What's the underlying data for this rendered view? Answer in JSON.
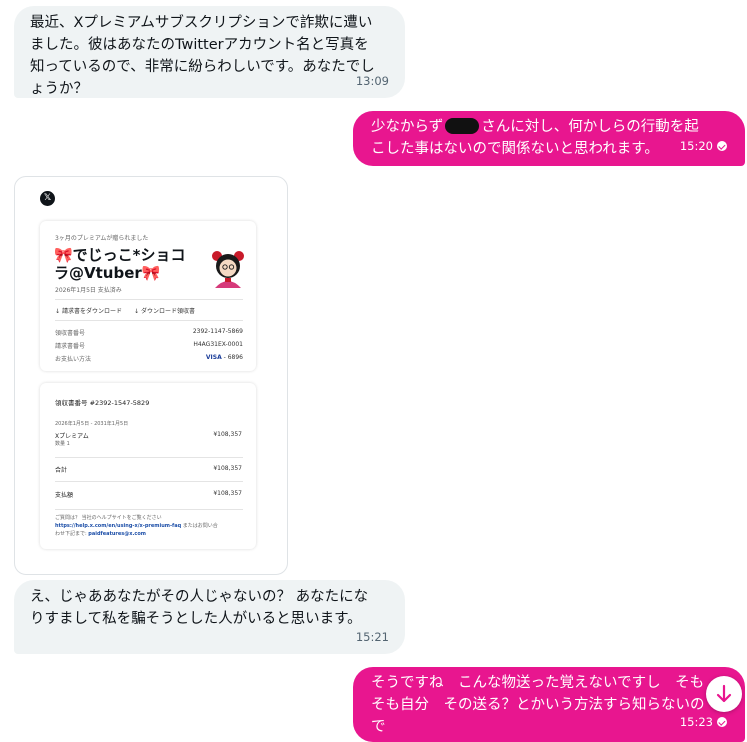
{
  "messages": [
    {
      "text": "最近、Xプレミアムサブスクリプションで詐欺に遭いました。彼はあなたのTwitterアカウント名と写真を知っているので、非常に紛らわしいです。あなたでしょうか？",
      "lines": [
        "最近、Xプレミアムサブスクリプションで詐欺に遭い",
        "ました。彼はあなたのTwitterアカウント名と写真を",
        "知っているので、非常に紛らわしいです。あなたでし",
        "ょうか？"
      ],
      "time": "13:09"
    },
    {
      "line1_pre": "少なからず",
      "line1_post": "さんに対し、何かしらの行動を起",
      "line2": "こした事はないので関係ないと思われます。",
      "time": "15:20"
    },
    {
      "lines": [
        "え、じゃああなたがその人じゃないの？ あなたにな",
        "りすまして私を騙そうとした人がいると思います。"
      ],
      "time": "15:21"
    },
    {
      "lines": [
        "そうですね　こんな物送った覚えないですし　そも",
        "そも自分　その送る？とかいう方法すら知らないの",
        "で"
      ],
      "time": "15:23"
    }
  ],
  "receipt": {
    "logo": "𝕏",
    "gift_note": "3ヶ月のプレミアムが贈られました",
    "name_line1": "🎀でじっこ*ショコ",
    "name_line2": "ラ@Vtuber🎀",
    "paid_date": "2026年1月5日 支払済み",
    "download_invoice": "請求書をダウンロード",
    "download_receipt": "ダウンロード領収書",
    "rows": [
      {
        "label": "領収書番号",
        "value": "2392-1147-5869"
      },
      {
        "label": "請求書番号",
        "value": "H4AG31EX-0001"
      },
      {
        "label": "お支払い方法",
        "value_brand": "VISA",
        "value": " - 6896"
      }
    ],
    "detail_title": "領収書番号 #2392-1547-5829",
    "period": "2026年1月5日 - 2031年1月5日",
    "item_name": "Xプレミアム",
    "item_qty": "数量 1",
    "item_price": "¥108,357",
    "total_label": "合計",
    "total_value": "¥108,357",
    "paid_label": "支払額",
    "paid_value": "¥108,357",
    "help_line1": "ご質問は？ 当社のヘルプサイトをご覧ください",
    "help_link": "https://help.x.com/en/using-x/x-premium-faq",
    "help_line2_suffix": " またはお問い合",
    "help_line3_prefix": "わせ下記まで: ",
    "help_email": "paidfeatures@x.com"
  },
  "icons": {
    "scroll_down": "arrow-down-icon",
    "read": "check-circle-icon"
  },
  "colors": {
    "accent": "#e8168f",
    "incoming": "#eff3f4"
  }
}
